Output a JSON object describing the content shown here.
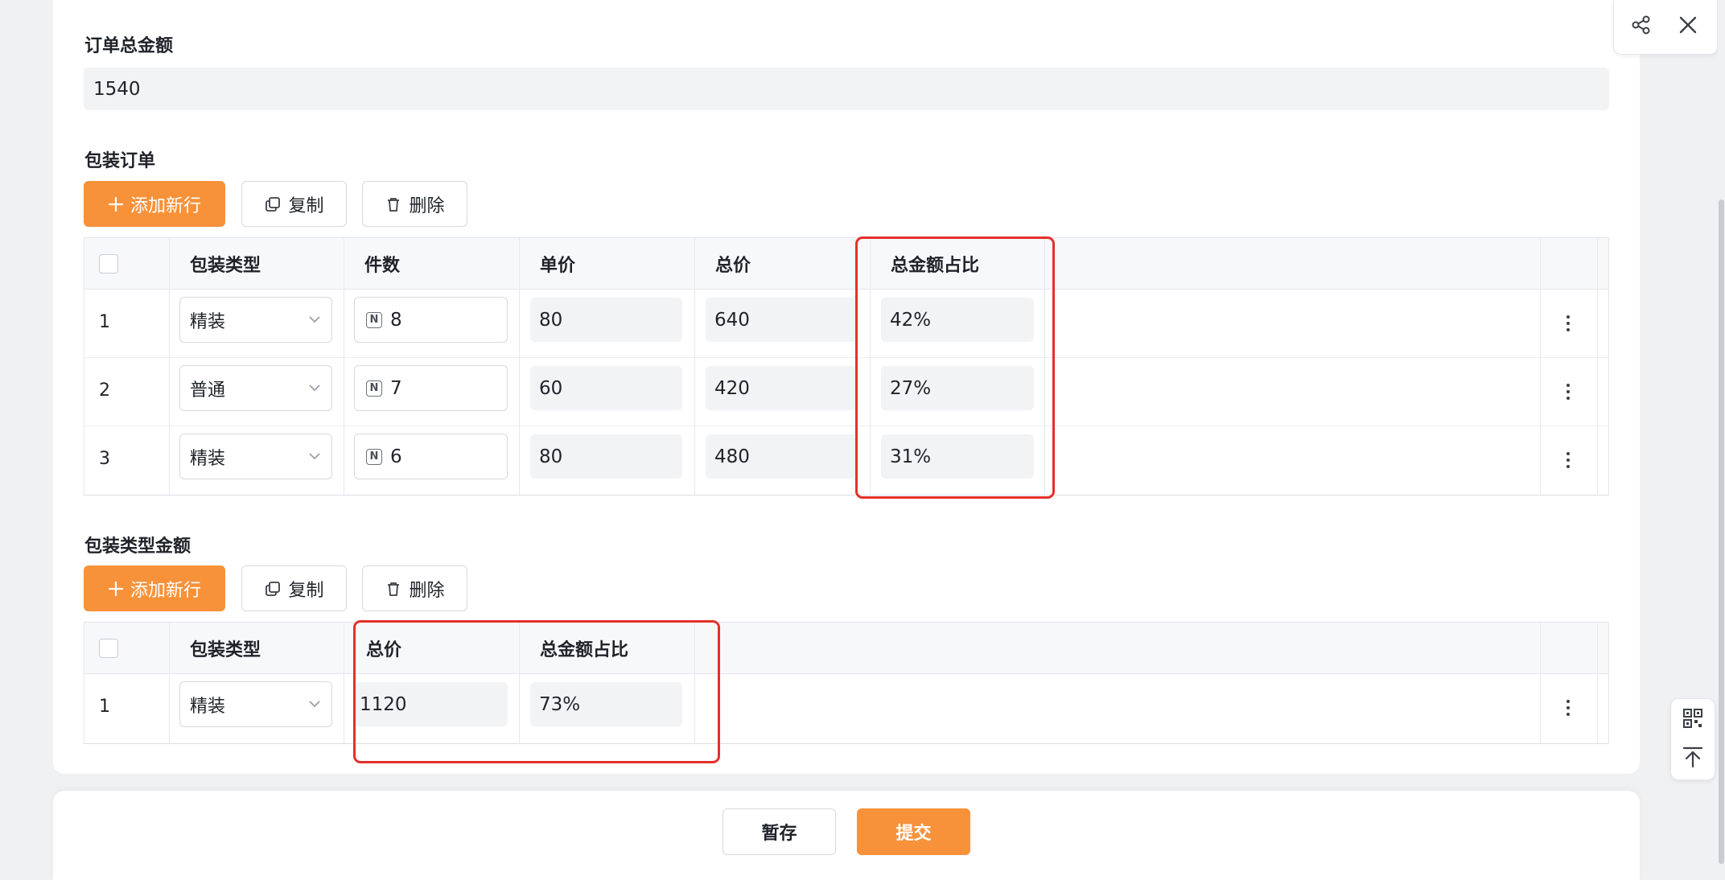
{
  "order_total": {
    "label": "订单总金额",
    "value": "1540"
  },
  "packaging_order": {
    "title": "包装订单",
    "buttons": {
      "add": "添加新行",
      "copy": "复制",
      "delete": "删除"
    },
    "columns": [
      "包装类型",
      "件数",
      "单价",
      "总价",
      "总金额占比"
    ],
    "rows": [
      {
        "index": "1",
        "type": "精装",
        "qty": "8",
        "unit_price": "80",
        "total": "640",
        "ratio": "42%"
      },
      {
        "index": "2",
        "type": "普通",
        "qty": "7",
        "unit_price": "60",
        "total": "420",
        "ratio": "27%"
      },
      {
        "index": "3",
        "type": "精装",
        "qty": "6",
        "unit_price": "80",
        "total": "480",
        "ratio": "31%"
      }
    ]
  },
  "type_amount": {
    "title": "包装类型金额",
    "buttons": {
      "add": "添加新行",
      "copy": "复制",
      "delete": "删除"
    },
    "columns": [
      "包装类型",
      "总价",
      "总金额占比"
    ],
    "rows": [
      {
        "index": "1",
        "type": "精装",
        "total": "1120",
        "ratio": "73%"
      }
    ]
  },
  "footer": {
    "save_draft": "暂存",
    "submit": "提交"
  },
  "colors": {
    "primary": "#f7923a",
    "highlight": "#e5302a",
    "field_bg": "#f2f3f5"
  },
  "icons": [
    "plus-icon",
    "copy-icon",
    "trash-icon",
    "chevron-down-icon",
    "number-icon",
    "more-vertical-icon",
    "share-icon",
    "close-icon",
    "qrcode-icon",
    "back-to-top-icon"
  ]
}
